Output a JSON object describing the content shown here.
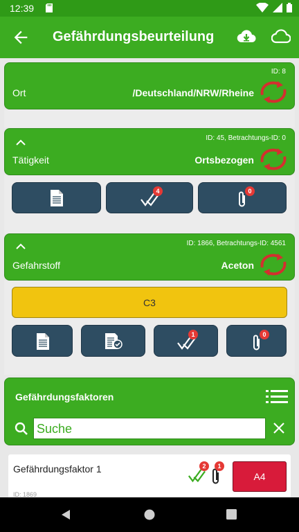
{
  "status": {
    "time": "12:39"
  },
  "appbar": {
    "title": "Gefährdungsbeurteilung"
  },
  "ort": {
    "id": "ID:  8",
    "label": "Ort",
    "value": "/Deutschland/NRW/Rheine"
  },
  "taetigkeit": {
    "id": "ID: 45, Betrachtungs-ID: 0",
    "label": "Tätigkeit",
    "value": "Ortsbezogen",
    "check_badge": "4",
    "attach_badge": "0"
  },
  "gefahrstoff": {
    "id": "ID: 1866, Betrachtungs-ID: 4561",
    "label": "Gefahrstoff",
    "value": "Aceton",
    "classification": "C3",
    "check_badge": "1",
    "attach_badge": "0"
  },
  "faktoren": {
    "title": "Gefährdungsfaktoren",
    "search_placeholder": "Suche",
    "items": [
      {
        "name": "Gefährdungsfaktor 1",
        "id": "ID:  1869",
        "check_badge": "2",
        "attach_badge": "1",
        "rating": "A4"
      }
    ]
  },
  "colors": {
    "green": "#3cac21",
    "dark_green": "#2f9a17",
    "button": "#2e4d62",
    "yellow": "#f1c40f",
    "red": "#e53935",
    "rating": "#d81b3a"
  }
}
